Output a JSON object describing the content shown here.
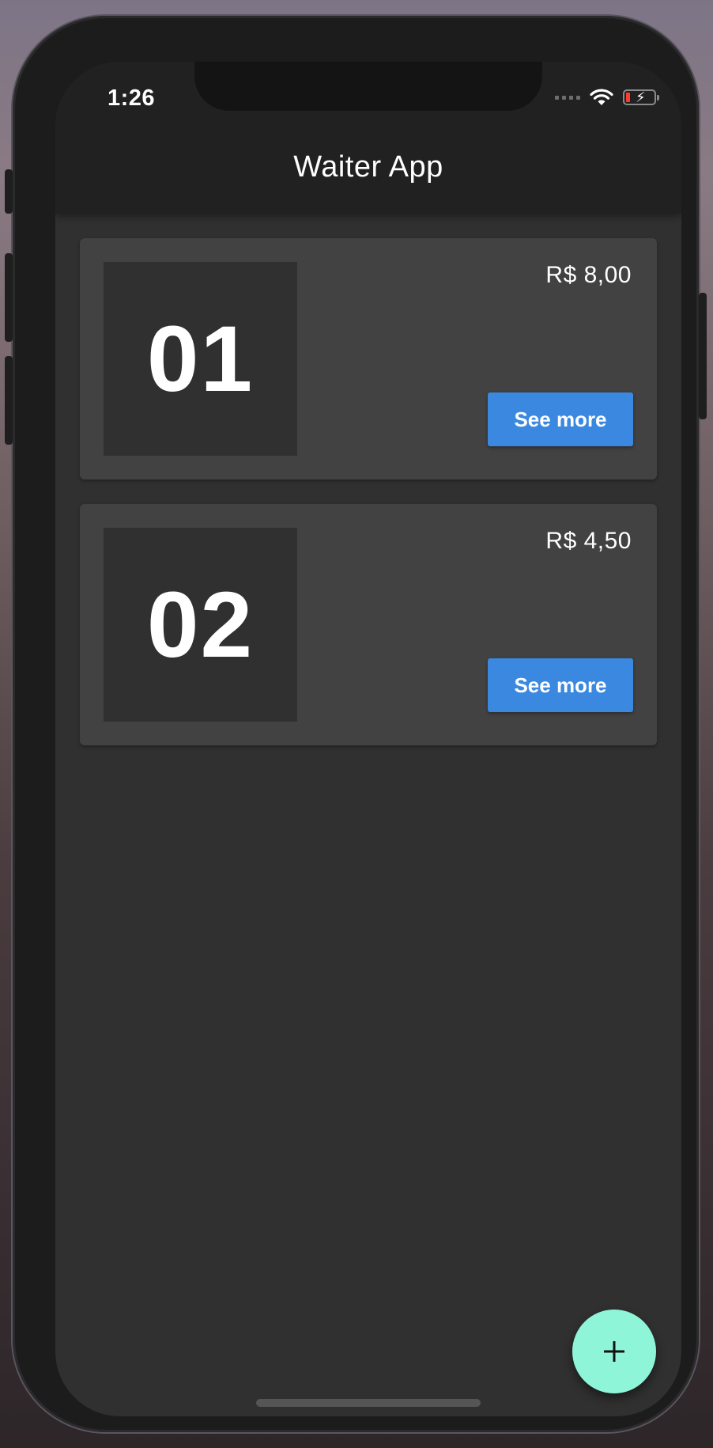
{
  "status_bar": {
    "time": "1:26",
    "icons": [
      "signal-dots-icon",
      "wifi-icon",
      "battery-charging-icon"
    ],
    "battery_color": "#ff3b30"
  },
  "app_bar": {
    "title": "Waiter App"
  },
  "orders": [
    {
      "table": "01",
      "price": "R$ 8,00",
      "button_label": "See more"
    },
    {
      "table": "02",
      "price": "R$ 4,50",
      "button_label": "See more"
    }
  ],
  "fab": {
    "icon": "plus-icon",
    "color": "#8ef5d8"
  },
  "colors": {
    "accent_button": "#3a88e0",
    "card": "#424242",
    "background": "#303030",
    "app_bar": "#212121"
  }
}
